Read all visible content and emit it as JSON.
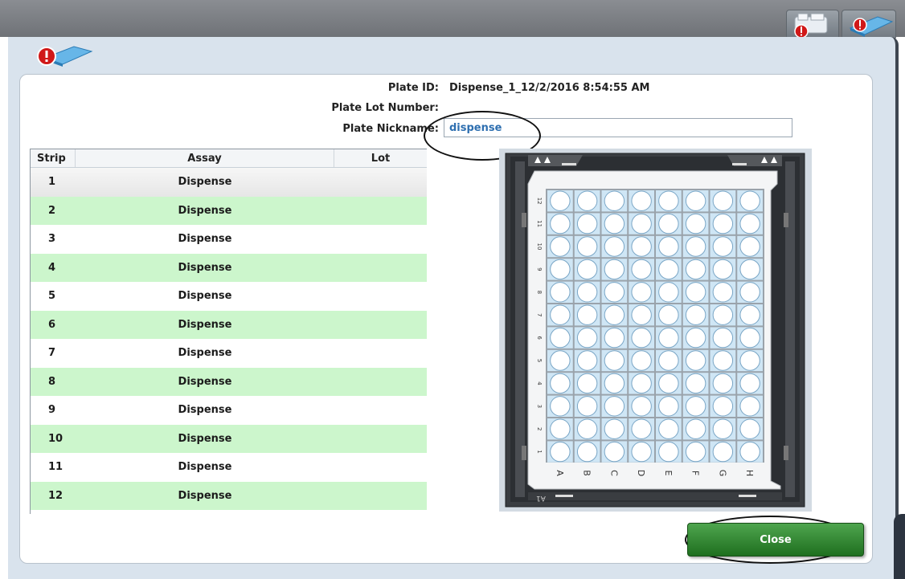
{
  "header": {
    "plate_id_label": "Plate ID:",
    "plate_id_value": "Dispense_1_12/2/2016 8:54:55 AM",
    "lot_number_label": "Plate Lot Number:",
    "lot_number_value": "",
    "nickname_label": "Plate Nickname:",
    "nickname_value": "dispense"
  },
  "table": {
    "columns": [
      "Strip",
      "Assay",
      "Lot"
    ],
    "rows": [
      {
        "strip": "1",
        "assay": "Dispense",
        "lot": ""
      },
      {
        "strip": "2",
        "assay": "Dispense",
        "lot": ""
      },
      {
        "strip": "3",
        "assay": "Dispense",
        "lot": ""
      },
      {
        "strip": "4",
        "assay": "Dispense",
        "lot": ""
      },
      {
        "strip": "5",
        "assay": "Dispense",
        "lot": ""
      },
      {
        "strip": "6",
        "assay": "Dispense",
        "lot": ""
      },
      {
        "strip": "7",
        "assay": "Dispense",
        "lot": ""
      },
      {
        "strip": "8",
        "assay": "Dispense",
        "lot": ""
      },
      {
        "strip": "9",
        "assay": "Dispense",
        "lot": ""
      },
      {
        "strip": "10",
        "assay": "Dispense",
        "lot": ""
      },
      {
        "strip": "11",
        "assay": "Dispense",
        "lot": ""
      },
      {
        "strip": "12",
        "assay": "Dispense",
        "lot": ""
      }
    ]
  },
  "plate": {
    "column_letters": [
      "A",
      "B",
      "C",
      "D",
      "E",
      "F",
      "G",
      "H"
    ],
    "row_numbers": [
      "12",
      "11",
      "10",
      "9",
      "8",
      "7",
      "6",
      "5",
      "4",
      "3",
      "2",
      "1"
    ],
    "corner_label": "A1"
  },
  "buttons": {
    "close_label": "Close"
  },
  "icons": {
    "app_icon": "plate-warning-icon",
    "toolbar_icon_1": "device-warning-icon",
    "toolbar_icon_2": "plate-warning-icon"
  },
  "colors": {
    "row_alt": "#ccf6cc",
    "close_button": "#2f8a2f",
    "well_fill": "#cfe6f5",
    "warning_red": "#d01818"
  }
}
